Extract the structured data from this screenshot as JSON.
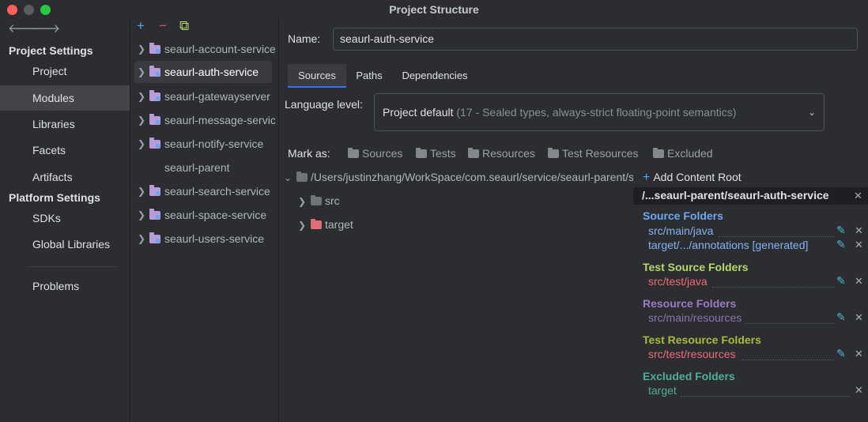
{
  "window": {
    "title": "Project Structure"
  },
  "nav": {
    "back": "🡐",
    "forward": "🡒"
  },
  "sidebar": {
    "project_settings_title": "Project Settings",
    "project_items": [
      "Project",
      "Modules",
      "Libraries",
      "Facets",
      "Artifacts"
    ],
    "platform_settings_title": "Platform Settings",
    "platform_items": [
      "SDKs",
      "Global Libraries"
    ],
    "problems": "Problems",
    "selected": "Modules"
  },
  "module_toolbar": {
    "add": "+",
    "remove": "−",
    "copy": "⧉"
  },
  "modules": [
    {
      "label": "seaurl-account-service",
      "expandable": true
    },
    {
      "label": "seaurl-auth-service",
      "expandable": true,
      "selected": true
    },
    {
      "label": "seaurl-gatewayserver",
      "expandable": true
    },
    {
      "label": "seaurl-message-service",
      "expandable": true
    },
    {
      "label": "seaurl-notify-service",
      "expandable": true
    },
    {
      "label": "seaurl-parent",
      "expandable": false
    },
    {
      "label": "seaurl-search-service",
      "expandable": true
    },
    {
      "label": "seaurl-space-service",
      "expandable": true
    },
    {
      "label": "seaurl-users-service",
      "expandable": true
    }
  ],
  "details": {
    "name_label": "Name:",
    "name_value": "seaurl-auth-service",
    "tabs": [
      "Sources",
      "Paths",
      "Dependencies"
    ],
    "active_tab": "Sources",
    "language_level_label": "Language level:",
    "language_level_value": "Project default",
    "language_level_detail": "(17 - Sealed types, always-strict floating-point semantics)",
    "mark_as_label": "Mark as:",
    "mark_as_options": [
      "Sources",
      "Tests",
      "Resources",
      "Test Resources",
      "Excluded"
    ]
  },
  "tree": {
    "root": "/Users/justinzhang/WorkSpace/com.seaurl/service/seaurl-parent/seaurl-auth-service",
    "children": [
      {
        "label": "src",
        "color": "#6f737a"
      },
      {
        "label": "target",
        "color": "#e06c75"
      }
    ]
  },
  "content_root": {
    "add_label": "Add Content Root",
    "path": "/...seaurl-parent/seaurl-auth-service",
    "groups": [
      {
        "title": "Source Folders",
        "color": "#6fa8f5",
        "entries": [
          "src/main/java",
          "target/.../annotations [generated]"
        ],
        "entry_color": "#86b2f5",
        "editable": true
      },
      {
        "title": "Test Source Folders",
        "color": "#b8d96b",
        "entries": [
          "src/test/java"
        ],
        "entry_color": "#f06b74",
        "editable": true
      },
      {
        "title": "Resource Folders",
        "color": "#9b7bc4",
        "entries": [
          "src/main/resources"
        ],
        "entry_color": "#8c72b0",
        "editable": true
      },
      {
        "title": "Test Resource Folders",
        "color": "#a6bd3a",
        "entries": [
          "src/test/resources"
        ],
        "entry_color": "#f06b74",
        "editable": true
      },
      {
        "title": "Excluded Folders",
        "color": "#4fae9b",
        "entries": [
          "target"
        ],
        "entry_color": "#4fae9b",
        "editable": false
      }
    ]
  }
}
